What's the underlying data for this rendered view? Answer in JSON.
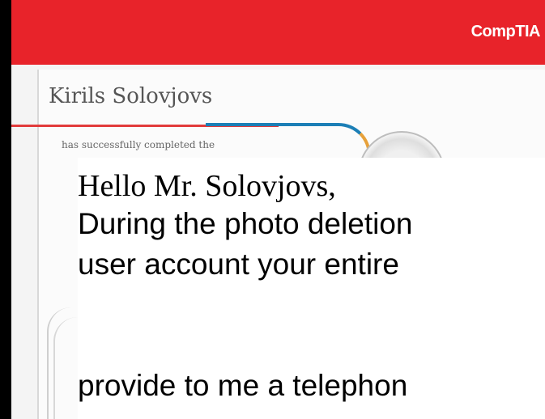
{
  "header": {
    "brand": "CompTIA",
    "brand_color": "#e8232a"
  },
  "certificate": {
    "recipient_name": "Kirils Solovjovs",
    "completed_text": "has successfully completed the"
  },
  "message": {
    "greeting": "Hello Mr. Solovjovs,",
    "line1": "During the photo deletion",
    "line2": "user account your entire",
    "line3": "provide to me a telephon"
  }
}
